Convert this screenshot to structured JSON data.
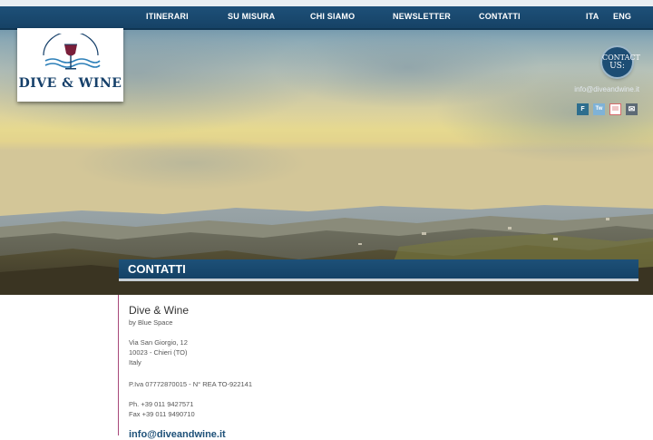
{
  "nav": {
    "items": [
      "ITINERARI",
      "SU MISURA",
      "CHI SIAMO",
      "NEWSLETTER",
      "CONTATTI"
    ],
    "languages": [
      "ITA",
      "ENG"
    ]
  },
  "logo": {
    "text": "DIVE & WINE",
    "arc_text": "BLUE SPACE"
  },
  "contact_badge": {
    "line1": "CONTACT",
    "line2": "US:"
  },
  "header_email": "info@diveandwine.it",
  "socials": [
    {
      "name": "flickr",
      "glyph": "F",
      "color": "#2e6e8e"
    },
    {
      "name": "twitter",
      "glyph": "Tw",
      "color": "#7fb2d6"
    },
    {
      "name": "blog",
      "glyph": "",
      "color": "#f0c6c6"
    },
    {
      "name": "email",
      "glyph": "✉",
      "color": "#5d6a75"
    }
  ],
  "section": {
    "title": "CONTATTI"
  },
  "company": {
    "name": "Dive & Wine",
    "subtitle": "by Blue Space",
    "address": [
      "Via San Giorgio, 12",
      "10023 - Chieri (TO)",
      "Italy"
    ],
    "vat": "P.Iva 07772870015 - N° REA TO-922141",
    "phone": "Ph. +39 011 9427571",
    "fax": "Fax +39 011 9490710",
    "email": "info@diveandwine.it"
  },
  "colors": {
    "navy": "#1d5078",
    "accent_line": "#a8487a"
  }
}
